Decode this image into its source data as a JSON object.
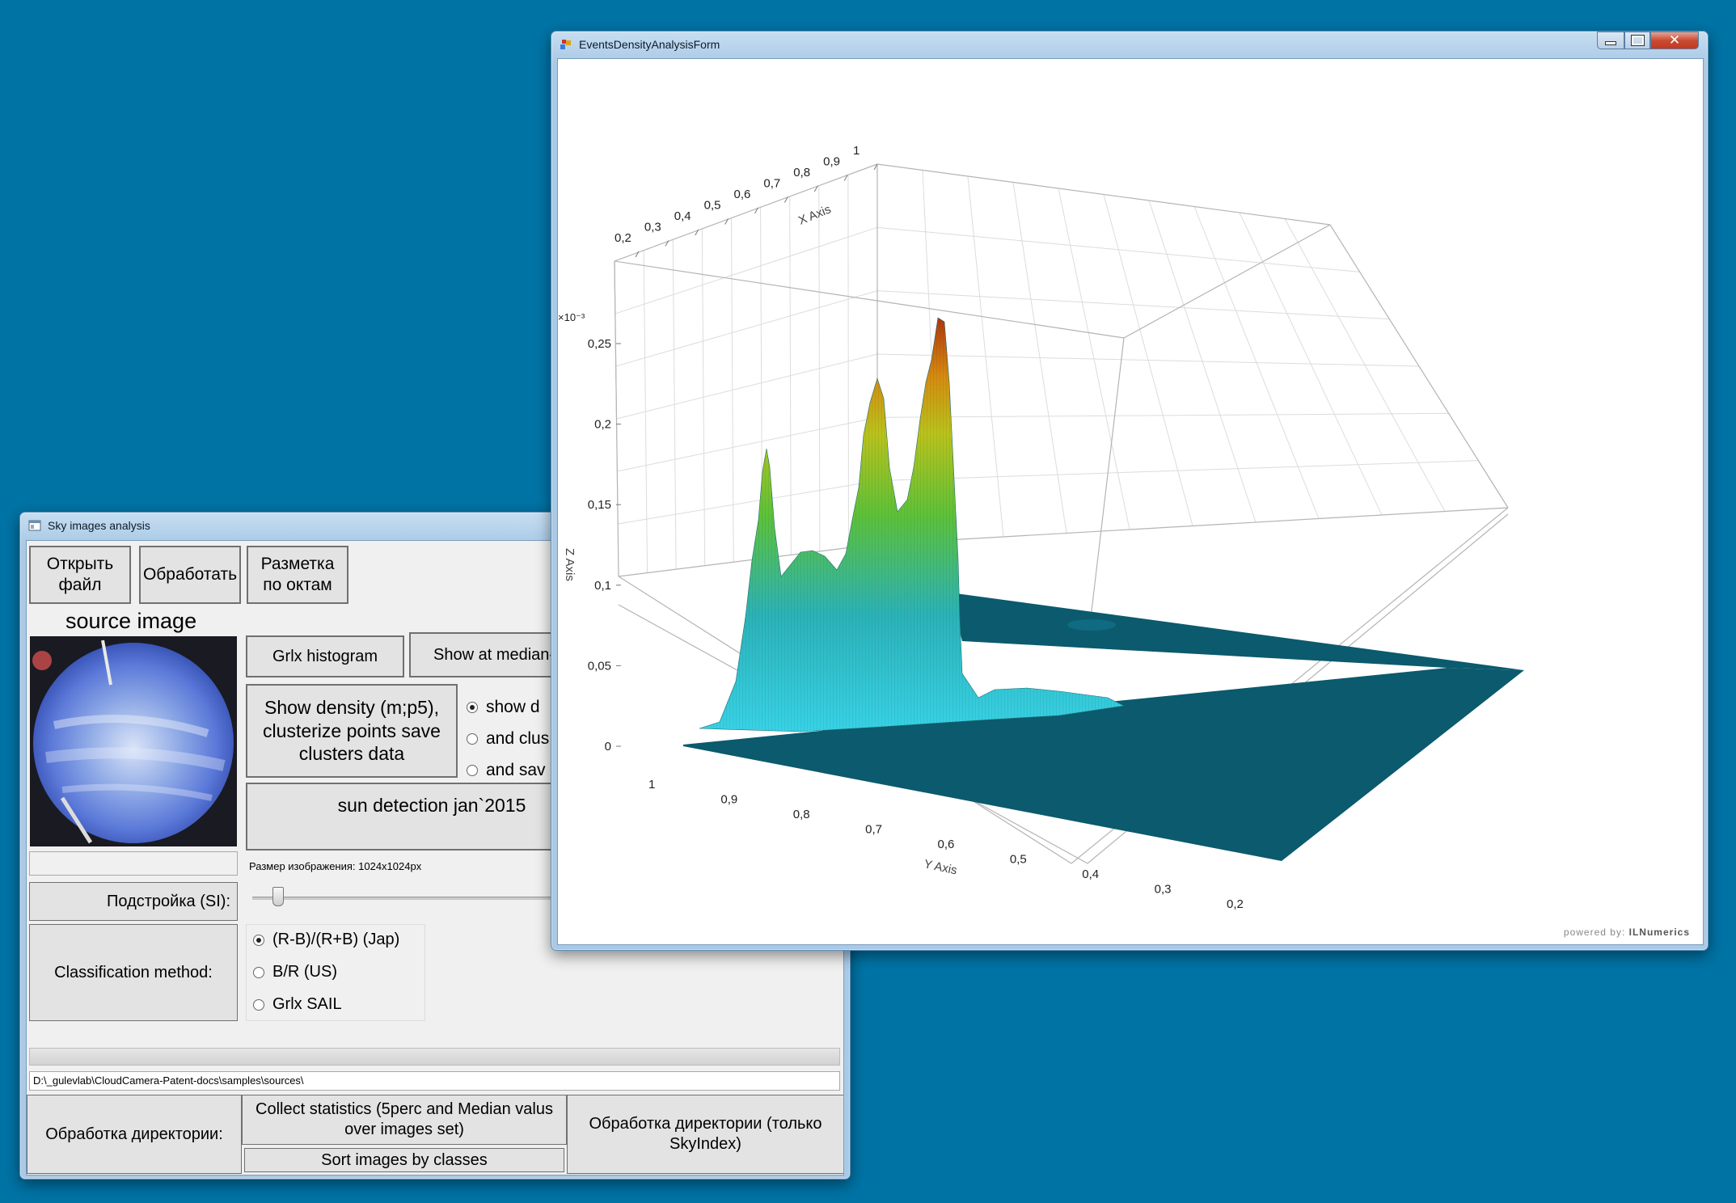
{
  "sky_window": {
    "title": "Sky images analysis",
    "open_file": "Открыть файл",
    "process": "Обработать",
    "markup": "Разметка по октам",
    "source_image_title": "source image",
    "grix_histogram": "Grlx histogram",
    "show_median": "Show at median-",
    "show_density": "Show density (m;p5), clusterize points save clusters data",
    "radio_show": "show d",
    "radio_cluster": "and clus",
    "radio_save": "and sav",
    "sun_detection": "sun detection jan`2015",
    "image_size": "Размер изображения: 1024x1024px",
    "tuning_label": "Подстройка (SI):",
    "slider_value": 0.06,
    "classification_label": "Classification method:",
    "class_jap": "(R-B)/(R+B)   (Jap)",
    "class_us": "B/R  (US)",
    "class_sail": "Grlx SAIL",
    "path": "D:\\_gulevlab\\CloudCamera-Patent-docs\\samples\\sources\\",
    "dir_label": "Обработка директории:",
    "collect_stats": "Collect statistics (5perc and Median valus over images set)",
    "sort_images": "Sort images by classes",
    "dir_skyindex": "Обработка директории (только SkyIndex)"
  },
  "density_window": {
    "title": "EventsDensityAnalysisForm",
    "powered_prefix": "powered by:",
    "powered_brand": "ILNumerics",
    "x_axis_label": "X Axis",
    "y_axis_label": "Y Axis",
    "z_axis_label": "Z Axis",
    "z_exponent": "×10⁻³",
    "x_ticks": [
      "0,2",
      "0,3",
      "0,4",
      "0,5",
      "0,6",
      "0,7",
      "0,8",
      "0,9",
      "1"
    ],
    "y_ticks": [
      "1",
      "0,9",
      "0,8",
      "0,7",
      "0,6",
      "0,5",
      "0,4",
      "0,3",
      "0,2"
    ],
    "z_ticks": [
      "0",
      "0,05",
      "0,1",
      "0,15",
      "0,2",
      "0,25"
    ]
  },
  "colors": {
    "desktop": "#0073a5",
    "surface_floor": "#0b5a6e"
  }
}
